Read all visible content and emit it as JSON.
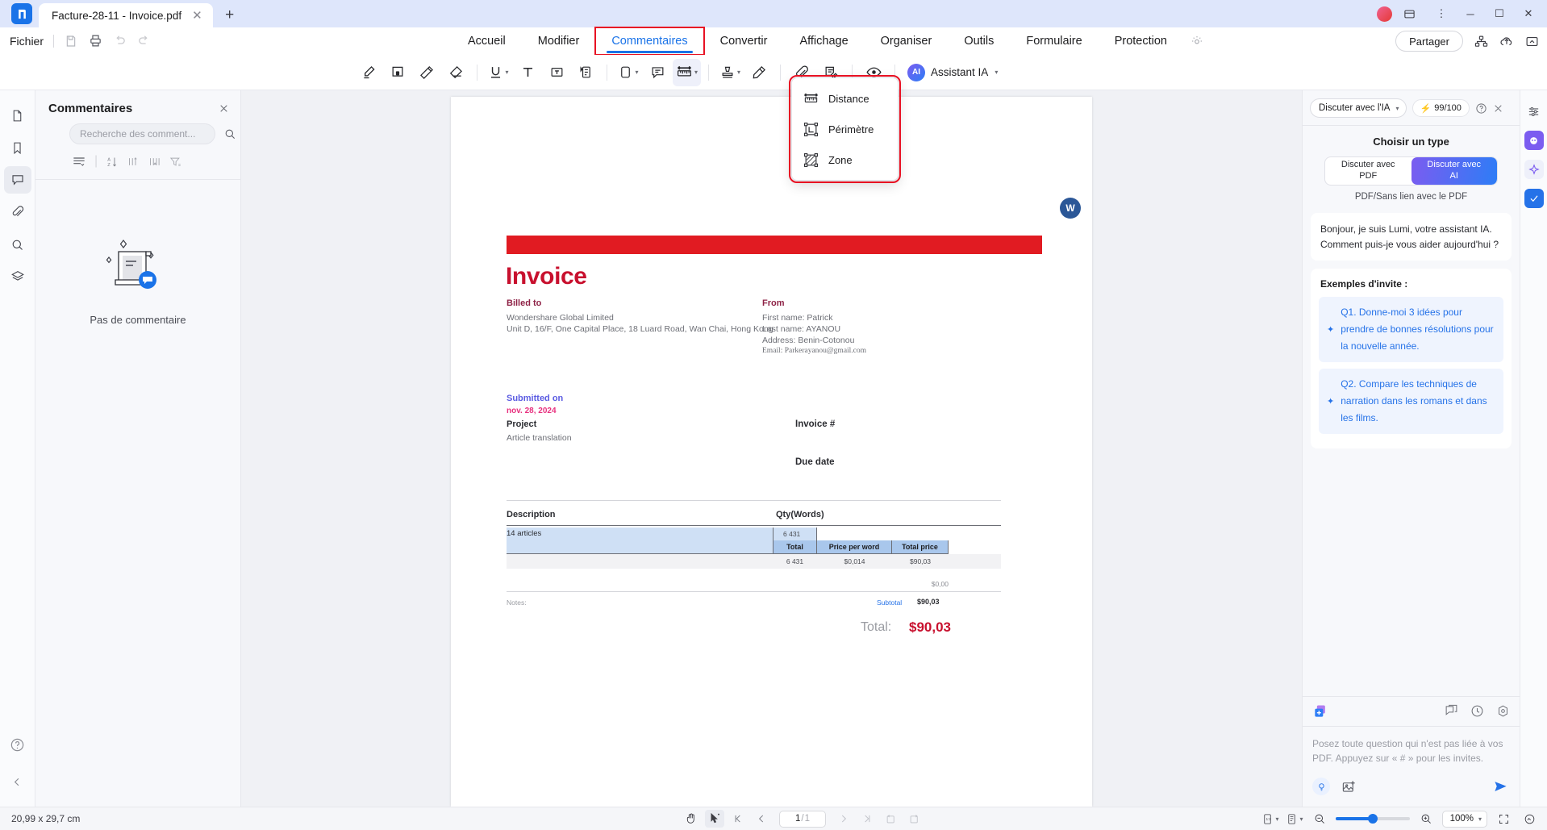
{
  "window": {
    "tab_title": "Facture-28-11 - Invoice.pdf",
    "close_tab_label": "✕",
    "new_tab_label": "+",
    "minimize_label": "─",
    "maximize_label": "☐",
    "close_label": "✕"
  },
  "menubar": {
    "file_label": "Fichier",
    "ribbon_tabs": [
      {
        "label": "Accueil",
        "active": false
      },
      {
        "label": "Modifier",
        "active": false
      },
      {
        "label": "Commentaires",
        "active": true
      },
      {
        "label": "Convertir",
        "active": false
      },
      {
        "label": "Affichage",
        "active": false
      },
      {
        "label": "Organiser",
        "active": false
      },
      {
        "label": "Outils",
        "active": false
      },
      {
        "label": "Formulaire",
        "active": false
      },
      {
        "label": "Protection",
        "active": false
      }
    ],
    "share_label": "Partager"
  },
  "toolbar": {
    "ai_assistant_label": "Assistant IA",
    "ai_badge_label": "AI"
  },
  "measure_menu": {
    "items": [
      {
        "label": "Distance",
        "icon": "distance-icon"
      },
      {
        "label": "Périmètre",
        "icon": "perimeter-icon"
      },
      {
        "label": "Zone",
        "icon": "area-icon"
      }
    ],
    "highlight_color": "#e81123"
  },
  "comments_panel": {
    "title": "Commentaires",
    "search_placeholder": "Recherche des comment...",
    "empty_text": "Pas de commentaire"
  },
  "document": {
    "title": "Invoice",
    "billed_to_label": "Billed to",
    "billed_to_name": "Wondershare Global Limited",
    "billed_to_address": "Unit D, 16/F, One Capital Place, 18 Luard Road, Wan Chai, Hong Kong",
    "from_label": "From",
    "from_first": "First name: Patrick",
    "from_last": "Last name: AYANOU",
    "from_address": "Address: Benin-Cotonou",
    "from_email": "Email: Parkerayanou@gmail.com",
    "submitted_label": "Submitted on",
    "submitted_date": "nov. 28, 2024",
    "project_label": "Project",
    "project_value": "Article translation",
    "invoice_number_label": "Invoice #",
    "due_date_label": "Due date",
    "table": {
      "col_description": "Description",
      "col_qty": "Qty(Words)",
      "row_description": "14 articles",
      "row_qty": "6 431",
      "sub_total_label": "Total",
      "sub_price_label": "Price per word",
      "sub_totalprice_label": "Total price",
      "val_total": "6 431",
      "val_price": "$0,014",
      "val_totalprice": "$90,03",
      "tax_value": "$0,00",
      "notes_label": "Notes:",
      "subtotal_label": "Subtotal",
      "subtotal_value": "$90,03"
    },
    "total_label": "Total:",
    "total_value": "$90,03",
    "word_badge_label": "W"
  },
  "ai_panel": {
    "mode_label": "Discuter avec l'IA",
    "credits_label": "99/100",
    "choose_type_title": "Choisir un type",
    "option_pdf_line1": "Discuter avec",
    "option_pdf_line2": "PDF",
    "option_ai_line1": "Discuter avec",
    "option_ai_line2": "AI",
    "caption": "PDF/Sans lien avec le PDF",
    "greeting": "Bonjour, je suis Lumi, votre assistant IA. Comment puis-je vous aider aujourd'hui ?",
    "examples_title": "Exemples d'invite :",
    "examples": [
      "Q1. Donne-moi 3 idées pour prendre de bonnes résolutions pour la nouvelle année.",
      "Q2. Compare les techniques de narration dans les romans et dans les films."
    ],
    "chat_placeholder": "Posez toute question qui n'est pas liée à vos PDF. Appuyez sur « # » pour les invites."
  },
  "statusbar": {
    "page_dimensions": "20,99 x 29,7 cm",
    "current_page": "1",
    "page_separator": "/",
    "total_pages": "1",
    "zoom_level": "100%"
  },
  "colors": {
    "accent_blue": "#1a73e8",
    "highlight_red": "#e81123",
    "invoice_red": "#c8102e",
    "ai_purple": "#7b5cf0"
  }
}
